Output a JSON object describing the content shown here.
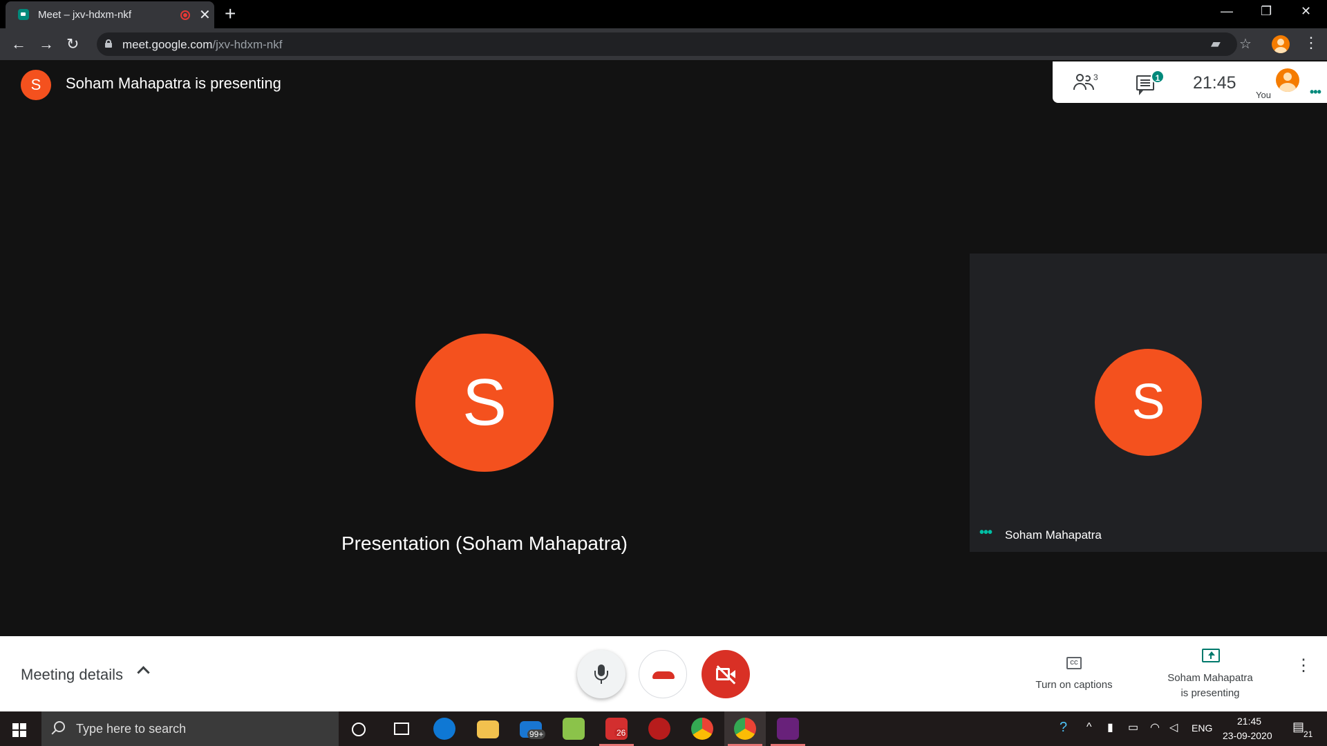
{
  "browser": {
    "tab_title": "Meet – jxv-hdxm-nkf",
    "tab_close": "✕",
    "new_tab": "+",
    "url_host": "meet.google.com",
    "url_path": "/jxv-hdxm-nkf",
    "window_controls": {
      "minimize": "—",
      "restore": "❐",
      "close": "✕"
    },
    "nav": {
      "back": "←",
      "forward": "→",
      "reload": "↻"
    },
    "menu_icon": "⋮"
  },
  "meet": {
    "presenter_initial": "S",
    "presenter_banner": "Soham Mahapatra is presenting",
    "people_count": "3",
    "chat_badge": "1",
    "time": "21:45",
    "you_label": "You",
    "main_tile": {
      "initial": "S",
      "caption": "Presentation (Soham Mahapatra)"
    },
    "side_tile": {
      "initial": "S",
      "name": "Soham Mahapatra"
    },
    "bottom": {
      "details_label": "Meeting details",
      "captions_label": "Turn on captions",
      "cc_icon_text": "CC",
      "presenting_line1": "Soham Mahapatra",
      "presenting_line2": "is presenting",
      "more_icon": "⋮"
    }
  },
  "taskbar": {
    "search_placeholder": "Type here to search",
    "mail_badge": "99+",
    "app_badge": "26",
    "lang": "ENG",
    "clock_time": "21:45",
    "clock_date": "23-09-2020",
    "notification_count": "21"
  },
  "colors": {
    "meet_background": "#121212",
    "avatar_orange": "#f4511e",
    "hangup_red": "#d93025",
    "accent_teal": "#00897b"
  }
}
